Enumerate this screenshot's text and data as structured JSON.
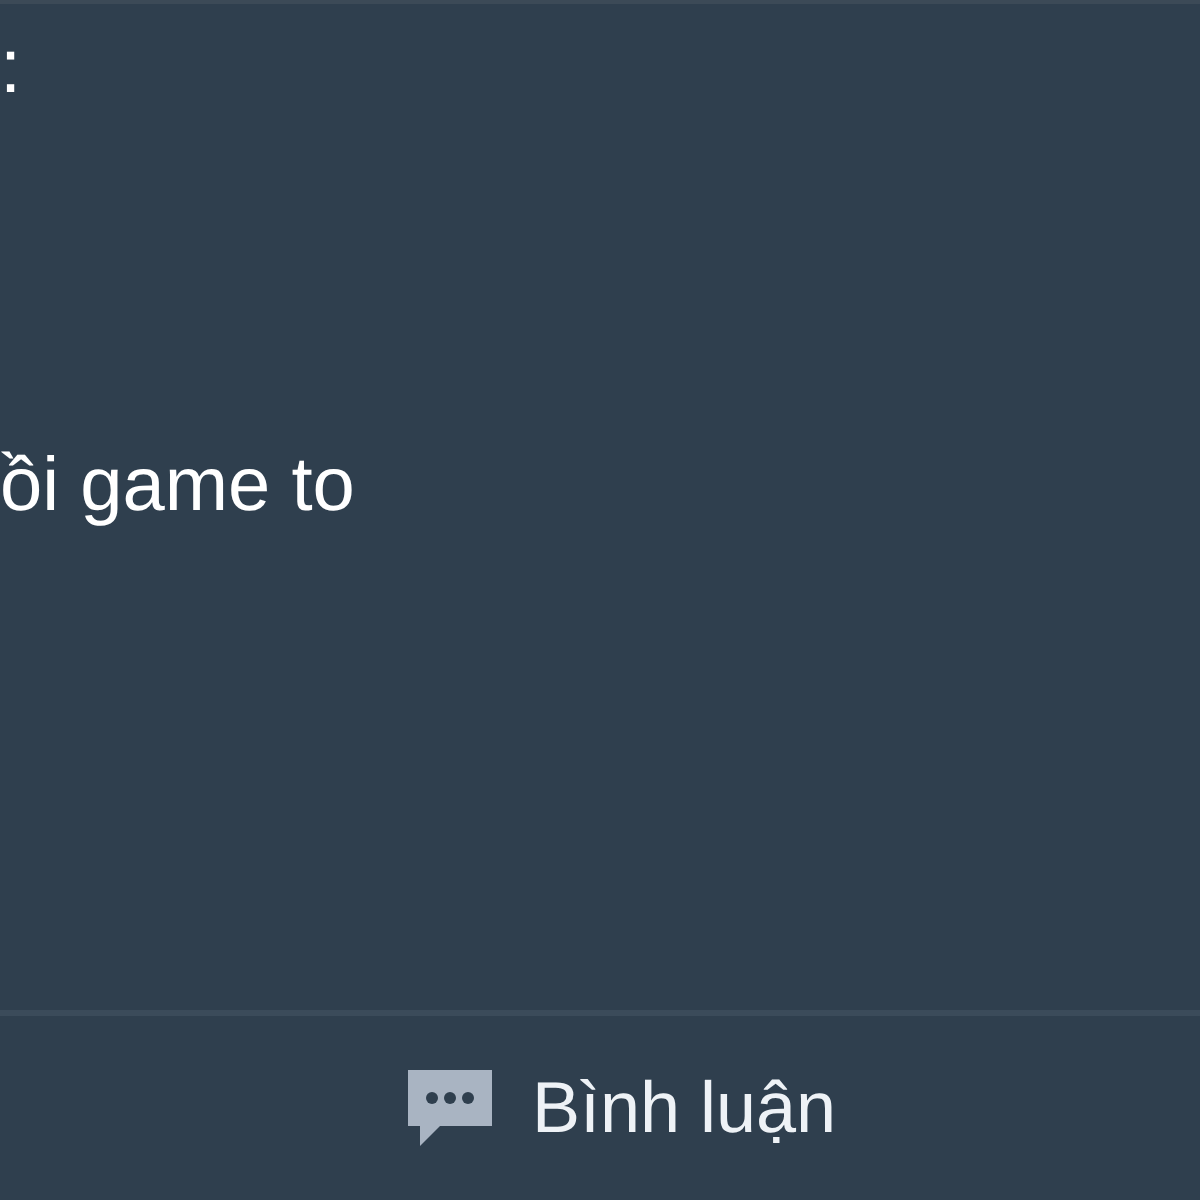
{
  "post": {
    "header_fragment": ":",
    "text": "ồi game to"
  },
  "actions": [
    {
      "kind": "comment",
      "label": "Bình luận"
    }
  ]
}
